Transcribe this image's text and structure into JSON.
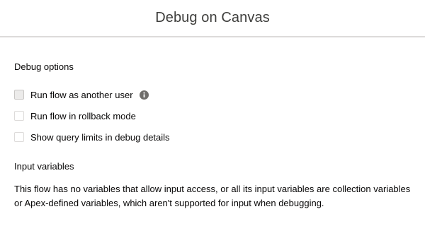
{
  "modal": {
    "title": "Debug on Canvas"
  },
  "debug_options": {
    "heading": "Debug options",
    "items": [
      {
        "label": "Run flow as another user",
        "checked": false,
        "disabled": true,
        "has_info_icon": true
      },
      {
        "label": "Run flow in rollback mode",
        "checked": false,
        "disabled": false
      },
      {
        "label": "Show query limits in debug details",
        "checked": false,
        "disabled": false
      }
    ]
  },
  "input_variables": {
    "heading": "Input variables",
    "message": "This flow has no variables that allow input access, or all its input variables are collection variables or Apex-defined variables, which aren't supported for input when debugging."
  },
  "icons": {
    "info": "info-icon"
  }
}
